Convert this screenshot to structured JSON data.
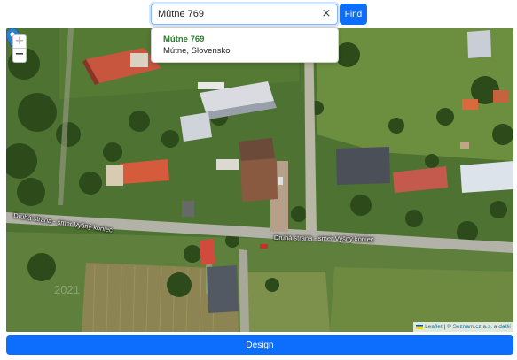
{
  "search": {
    "value": "Mútne 769",
    "clear_glyph": "×",
    "find_label": "Find"
  },
  "suggestions": [
    {
      "title": "Mútne 769",
      "subtitle": "Mútne, Slovensko"
    }
  ],
  "map": {
    "zoom_in_glyph": "+",
    "zoom_out_glyph": "−",
    "streets": [
      "Druhá strana - smer Vyšný koniec",
      "Druhá strana - smer Vyšný koniec"
    ],
    "imagery_year": "2021",
    "marker_icon": "map-pin-icon",
    "attribution": {
      "leaflet_label": "Leaflet",
      "separator": " | ",
      "copyright": "© Seznam.cz a.s. a další"
    }
  },
  "actions": {
    "design_label": "Design"
  },
  "colors": {
    "primary": "#0d6efd",
    "suggestion_title": "#287d2c",
    "marker": "#2a81cb"
  }
}
